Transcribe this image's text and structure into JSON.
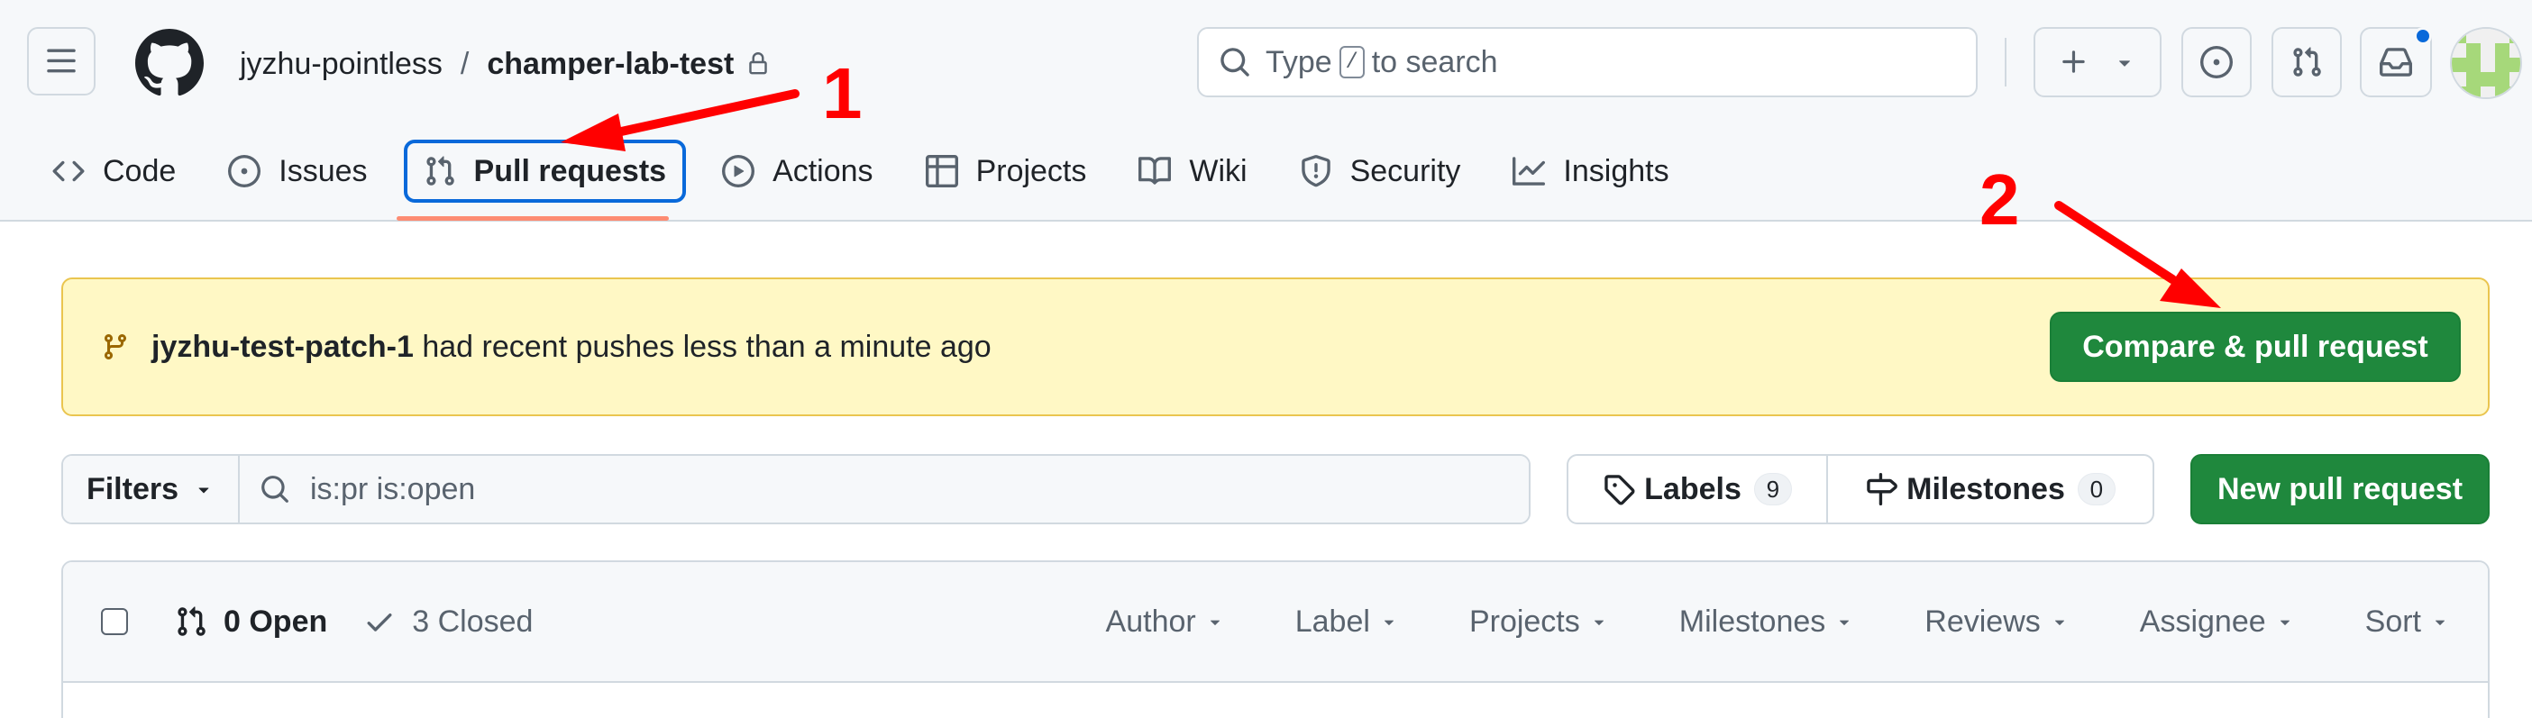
{
  "header": {
    "owner": "jyzhu-pointless",
    "separator": "/",
    "repo": "champer-lab-test",
    "search_prefix": "Type",
    "search_key": "/",
    "search_suffix": "to search"
  },
  "nav": {
    "tabs": [
      {
        "label": "Code",
        "icon": "code-icon"
      },
      {
        "label": "Issues",
        "icon": "issue-opened-icon"
      },
      {
        "label": "Pull requests",
        "icon": "git-pull-request-icon",
        "selected": true
      },
      {
        "label": "Actions",
        "icon": "play-icon"
      },
      {
        "label": "Projects",
        "icon": "table-icon"
      },
      {
        "label": "Wiki",
        "icon": "book-icon"
      },
      {
        "label": "Security",
        "icon": "shield-icon"
      },
      {
        "label": "Insights",
        "icon": "graph-icon"
      }
    ]
  },
  "banner": {
    "branch": "jyzhu-test-patch-1",
    "message": " had recent pushes less than a minute ago",
    "button": "Compare & pull request"
  },
  "filter_bar": {
    "filters_label": "Filters",
    "query": "is:pr is:open",
    "labels_label": "Labels",
    "labels_count": "9",
    "milestones_label": "Milestones",
    "milestones_count": "0",
    "new_pr_button": "New pull request"
  },
  "list": {
    "open_label": "0 Open",
    "closed_label": "3 Closed",
    "sort_menus": [
      "Author",
      "Label",
      "Projects",
      "Milestones",
      "Reviews",
      "Assignee",
      "Sort"
    ]
  },
  "annotations": {
    "step1": "1",
    "step2": "2"
  },
  "colors": {
    "primary_button": "#1f883d",
    "accent": "#0969da",
    "tab_underline": "#fd8c73",
    "banner_bg": "#fff8c5",
    "annotation": "#ff0000"
  }
}
